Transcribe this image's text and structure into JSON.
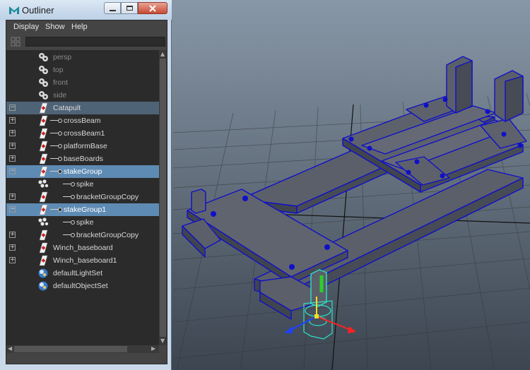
{
  "window": {
    "title": "Outliner"
  },
  "menu": [
    "Display",
    "Show",
    "Help"
  ],
  "search": {
    "value": ""
  },
  "tree": [
    {
      "label": "persp",
      "icon": "camera-icon",
      "expander": "",
      "indent": 0,
      "style": "camera"
    },
    {
      "label": "top",
      "icon": "camera-icon",
      "expander": "",
      "indent": 0,
      "style": "camera"
    },
    {
      "label": "front",
      "icon": "camera-icon",
      "expander": "",
      "indent": 0,
      "style": "camera"
    },
    {
      "label": "side",
      "icon": "camera-icon",
      "expander": "",
      "indent": 0,
      "style": "camera"
    },
    {
      "label": "Catapult",
      "icon": "group-icon",
      "expander": "−",
      "indent": 0,
      "style": "selected"
    },
    {
      "label": "crossBeam",
      "icon": "group-icon",
      "expander": "+",
      "indent": 1,
      "style": "normal"
    },
    {
      "label": "crossBeam1",
      "icon": "group-icon",
      "expander": "+",
      "indent": 1,
      "style": "normal"
    },
    {
      "label": "platformBase",
      "icon": "group-icon",
      "expander": "+",
      "indent": 1,
      "style": "normal"
    },
    {
      "label": "baseBoards",
      "icon": "group-icon",
      "expander": "+",
      "indent": 1,
      "style": "normal"
    },
    {
      "label": "stakeGroup",
      "icon": "group-icon",
      "expander": "−",
      "indent": 1,
      "style": "highlight"
    },
    {
      "label": "spike",
      "icon": "mesh-icon",
      "expander": "",
      "indent": 2,
      "style": "normal"
    },
    {
      "label": "bracketGroupCopy",
      "icon": "group-icon",
      "expander": "+",
      "indent": 2,
      "style": "normal"
    },
    {
      "label": "stakeGroup1",
      "icon": "group-icon",
      "expander": "−",
      "indent": 1,
      "style": "highlight"
    },
    {
      "label": "spike",
      "icon": "mesh-icon",
      "expander": "",
      "indent": 2,
      "style": "normal"
    },
    {
      "label": "bracketGroupCopy",
      "icon": "group-icon",
      "expander": "+",
      "indent": 2,
      "style": "normal"
    },
    {
      "label": "Winch_baseboard",
      "icon": "group-icon",
      "expander": "+",
      "indent": 0,
      "style": "normal"
    },
    {
      "label": "Winch_baseboard1",
      "icon": "group-icon",
      "expander": "+",
      "indent": 0,
      "style": "normal"
    },
    {
      "label": "defaultLightSet",
      "icon": "set-icon",
      "expander": "",
      "indent": 0,
      "style": "normal"
    },
    {
      "label": "defaultObjectSet",
      "icon": "set-icon",
      "expander": "",
      "indent": 0,
      "style": "normal"
    }
  ],
  "colors": {
    "viewport_top": "#8393a3",
    "viewport_bottom": "#3e4750",
    "selected_row": "#4f6376",
    "highlight_row": "#5e8bb4",
    "wireframe": "#1010c8",
    "manipulator": "#2de0c8"
  }
}
